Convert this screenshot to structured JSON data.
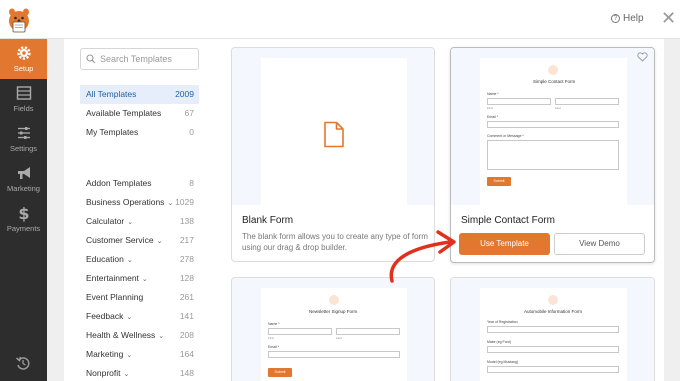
{
  "header": {
    "help_label": "Help"
  },
  "nav": {
    "items": [
      {
        "label": "Setup"
      },
      {
        "label": "Fields"
      },
      {
        "label": "Settings"
      },
      {
        "label": "Marketing"
      },
      {
        "label": "Payments"
      }
    ]
  },
  "search": {
    "placeholder": "Search Templates"
  },
  "categories_top": [
    {
      "label": "All Templates",
      "count": "2009"
    },
    {
      "label": "Available Templates",
      "count": "67"
    },
    {
      "label": "My Templates",
      "count": "0"
    }
  ],
  "categories": [
    {
      "label": "Addon Templates",
      "count": "8",
      "chevron": ""
    },
    {
      "label": "Business Operations",
      "count": "1029",
      "chevron": "⌄"
    },
    {
      "label": "Calculator",
      "count": "138",
      "chevron": "⌄"
    },
    {
      "label": "Customer Service",
      "count": "217",
      "chevron": "⌄"
    },
    {
      "label": "Education",
      "count": "278",
      "chevron": "⌄"
    },
    {
      "label": "Entertainment",
      "count": "128",
      "chevron": "⌄"
    },
    {
      "label": "Event Planning",
      "count": "261",
      "chevron": ""
    },
    {
      "label": "Feedback",
      "count": "141",
      "chevron": "⌄"
    },
    {
      "label": "Health & Wellness",
      "count": "208",
      "chevron": "⌄"
    },
    {
      "label": "Marketing",
      "count": "164",
      "chevron": "⌄"
    },
    {
      "label": "Nonprofit",
      "count": "148",
      "chevron": "⌄"
    }
  ],
  "blank_card": {
    "title": "Blank Form",
    "desc_line1": "The blank form allows you to create any type of form",
    "desc_line2": "using our drag & drop builder."
  },
  "contact_card": {
    "title": "Simple Contact Form",
    "use_label": "Use Template",
    "demo_label": "View Demo",
    "form": {
      "title": "Simple Contact Form",
      "name_label": "Name *",
      "first": "First",
      "last": "Last",
      "email_label": "Email *",
      "comment_label": "Comment or Message *",
      "submit": "Submit"
    }
  },
  "newsletter_card": {
    "form": {
      "title": "Newsletter Signup Form",
      "name_label": "Name *",
      "first": "First",
      "last": "Last",
      "email_label": "Email *",
      "submit": "Submit"
    }
  },
  "auto_card": {
    "form": {
      "title": "Automobile Information Form",
      "field1": "Year of Registration",
      "field2": "Make (eg Ford)",
      "field3": "Model (eg Mustang)"
    }
  },
  "colors": {
    "accent": "#e27730",
    "nav_bg": "#2d2d2d",
    "active_cat": "#e5eefa",
    "arrow": "#e0301e"
  }
}
